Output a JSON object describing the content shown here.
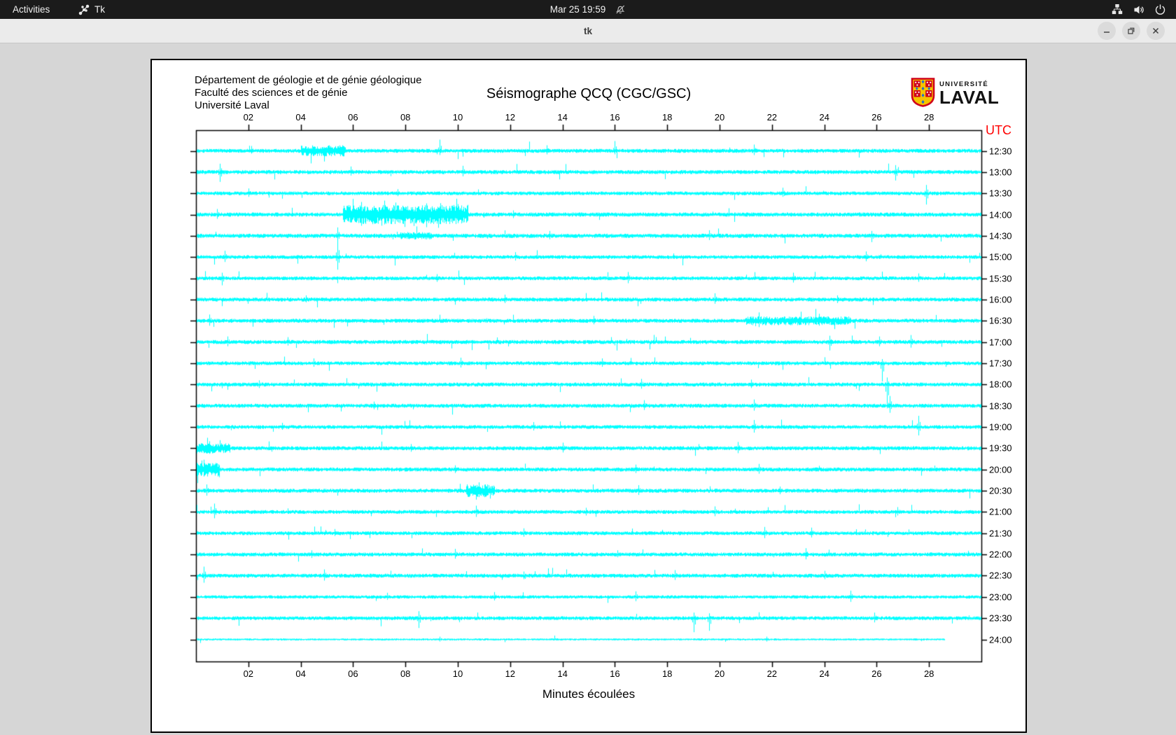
{
  "topbar": {
    "activities_label": "Activities",
    "app_name": "Tk",
    "clock": "Mar 25 19:59",
    "icons": [
      "tk-icon",
      "notifications-off-icon",
      "network-icon",
      "volume-icon",
      "power-icon"
    ]
  },
  "window": {
    "title": "tk",
    "control_icons": [
      "minimize-icon",
      "maximize-icon",
      "close-icon"
    ]
  },
  "header": {
    "department_lines": [
      "Département de géologie et de génie géologique",
      "Faculté des sciences et de génie",
      "Université Laval"
    ],
    "logo": {
      "small_text": "UNIVERSITÉ",
      "large_text": "LAVAL"
    }
  },
  "chart_data": {
    "type": "line",
    "subtype": "helicorder-seismogram",
    "title": "Séismographe QCQ (CGC/GSC)",
    "xlabel": "Minutes écoulées",
    "right_axis_title": "UTC",
    "right_axis_title_color": "#ff0000",
    "trace_color": "#00ffff",
    "axis_color": "#000000",
    "x_range_minutes": [
      0,
      30
    ],
    "x_ticks": [
      "02",
      "04",
      "06",
      "08",
      "10",
      "12",
      "14",
      "16",
      "18",
      "20",
      "22",
      "24",
      "26",
      "28"
    ],
    "grid": false,
    "legend": "none",
    "rows": [
      {
        "label": "12:30",
        "seed": 101,
        "noise": 1.8,
        "srate": 0.01,
        "samp": 11,
        "bursts": [
          {
            "from": 4.0,
            "to": 5.7,
            "gain": 2.8
          }
        ],
        "events": [
          {
            "at": 2.1,
            "up": 7,
            "dn": 4
          },
          {
            "at": 9.3,
            "up": 16,
            "dn": 6
          },
          {
            "at": 13.4,
            "up": 8,
            "dn": 5
          },
          {
            "at": 16.0,
            "up": 14,
            "dn": 5
          },
          {
            "at": 21.3,
            "up": 9,
            "dn": 6
          }
        ],
        "end": 30
      },
      {
        "label": "13:00",
        "seed": 102,
        "noise": 1.8,
        "srate": 0.009,
        "samp": 10,
        "bursts": [],
        "events": [
          {
            "at": 0.9,
            "up": 12,
            "dn": 14
          },
          {
            "at": 5.9,
            "up": 8,
            "dn": 5
          },
          {
            "at": 10.2,
            "up": 9,
            "dn": 6
          },
          {
            "at": 26.7,
            "up": 10,
            "dn": 12
          }
        ],
        "end": 30
      },
      {
        "label": "13:30",
        "seed": 103,
        "noise": 1.7,
        "srate": 0.008,
        "samp": 9,
        "bursts": [],
        "events": [
          {
            "at": 2.0,
            "up": 7,
            "dn": 5
          },
          {
            "at": 7.7,
            "up": 6,
            "dn": 4
          },
          {
            "at": 22.4,
            "up": 8,
            "dn": 5
          },
          {
            "at": 27.9,
            "up": 12,
            "dn": 16
          }
        ],
        "end": 30
      },
      {
        "label": "14:00",
        "seed": 104,
        "noise": 1.9,
        "srate": 0.011,
        "samp": 11,
        "bursts": [
          {
            "from": 5.6,
            "to": 10.4,
            "gain": 4.5
          }
        ],
        "events": [
          {
            "at": 0.8,
            "up": 8,
            "dn": 6
          },
          {
            "at": 6.3,
            "up": 18,
            "dn": 16
          },
          {
            "at": 7.2,
            "up": 20,
            "dn": 14
          },
          {
            "at": 8.8,
            "up": 16,
            "dn": 18
          },
          {
            "at": 10.0,
            "up": 15,
            "dn": 12
          },
          {
            "at": 12.1,
            "up": 6,
            "dn": 5
          }
        ],
        "end": 30
      },
      {
        "label": "14:30",
        "seed": 105,
        "noise": 1.9,
        "srate": 0.01,
        "samp": 10,
        "bursts": [
          {
            "from": 7.8,
            "to": 9.0,
            "gain": 1.8
          }
        ],
        "events": [
          {
            "at": 5.4,
            "up": 12,
            "dn": 9
          },
          {
            "at": 13.5,
            "up": 7,
            "dn": 5
          },
          {
            "at": 19.6,
            "up": 8,
            "dn": 6
          },
          {
            "at": 25.8,
            "up": 7,
            "dn": 9
          }
        ],
        "end": 30
      },
      {
        "label": "15:00",
        "seed": 106,
        "noise": 1.7,
        "srate": 0.009,
        "samp": 10,
        "bursts": [],
        "events": [
          {
            "at": 1.1,
            "up": 9,
            "dn": 7
          },
          {
            "at": 5.4,
            "up": 22,
            "dn": 18
          },
          {
            "at": 12.2,
            "up": 7,
            "dn": 5
          },
          {
            "at": 25.6,
            "up": 8,
            "dn": 6
          }
        ],
        "end": 30
      },
      {
        "label": "15:30",
        "seed": 107,
        "noise": 1.7,
        "srate": 0.009,
        "samp": 10,
        "bursts": [],
        "events": [
          {
            "at": 1.0,
            "up": 8,
            "dn": 10
          },
          {
            "at": 9.2,
            "up": 6,
            "dn": 5
          },
          {
            "at": 16.5,
            "up": 9,
            "dn": 7
          },
          {
            "at": 22.8,
            "up": 8,
            "dn": 6
          },
          {
            "at": 27.6,
            "up": 7,
            "dn": 5
          }
        ],
        "end": 30
      },
      {
        "label": "16:00",
        "seed": 108,
        "noise": 1.8,
        "srate": 0.008,
        "samp": 9,
        "bursts": [],
        "events": [
          {
            "at": 4.2,
            "up": 6,
            "dn": 4
          },
          {
            "at": 11.8,
            "up": 7,
            "dn": 5
          },
          {
            "at": 19.8,
            "up": 9,
            "dn": 6
          },
          {
            "at": 24.5,
            "up": 6,
            "dn": 5
          }
        ],
        "end": 30
      },
      {
        "label": "16:30",
        "seed": 109,
        "noise": 1.8,
        "srate": 0.01,
        "samp": 10,
        "bursts": [
          {
            "from": 21.0,
            "to": 25.0,
            "gain": 2.2
          }
        ],
        "events": [
          {
            "at": 0.5,
            "up": 9,
            "dn": 7
          },
          {
            "at": 15.2,
            "up": 7,
            "dn": 5
          },
          {
            "at": 21.5,
            "up": 12,
            "dn": 9
          },
          {
            "at": 23.8,
            "up": 10,
            "dn": 7
          }
        ],
        "end": 30
      },
      {
        "label": "17:00",
        "seed": 110,
        "noise": 1.8,
        "srate": 0.009,
        "samp": 10,
        "bursts": [],
        "events": [
          {
            "at": 1.2,
            "up": 8,
            "dn": 6
          },
          {
            "at": 3.5,
            "up": 7,
            "dn": 5
          },
          {
            "at": 24.2,
            "up": 9,
            "dn": 12
          },
          {
            "at": 26.1,
            "up": 8,
            "dn": 6
          },
          {
            "at": 27.3,
            "up": 10,
            "dn": 8
          }
        ],
        "end": 30
      },
      {
        "label": "17:30",
        "seed": 111,
        "noise": 1.7,
        "srate": 0.009,
        "samp": 9,
        "bursts": [],
        "events": [
          {
            "at": 4.5,
            "up": 7,
            "dn": 5
          },
          {
            "at": 10.1,
            "up": 8,
            "dn": 6
          },
          {
            "at": 15.5,
            "up": 7,
            "dn": 5
          },
          {
            "at": 26.2,
            "up": 6,
            "dn": 26
          }
        ],
        "end": 30
      },
      {
        "label": "18:00",
        "seed": 112,
        "noise": 1.8,
        "srate": 0.009,
        "samp": 10,
        "bursts": [],
        "events": [
          {
            "at": 2.4,
            "up": 6,
            "dn": 5
          },
          {
            "at": 17.0,
            "up": 8,
            "dn": 6
          },
          {
            "at": 21.2,
            "up": 7,
            "dn": 5
          },
          {
            "at": 26.4,
            "up": 10,
            "dn": 34
          }
        ],
        "end": 30
      },
      {
        "label": "18:30",
        "seed": 113,
        "noise": 1.8,
        "srate": 0.009,
        "samp": 10,
        "bursts": [],
        "events": [
          {
            "at": 6.8,
            "up": 6,
            "dn": 5
          },
          {
            "at": 17.1,
            "up": 8,
            "dn": 6
          },
          {
            "at": 21.3,
            "up": 9,
            "dn": 7
          },
          {
            "at": 26.5,
            "up": 14,
            "dn": 10
          }
        ],
        "end": 30
      },
      {
        "label": "19:00",
        "seed": 114,
        "noise": 1.7,
        "srate": 0.009,
        "samp": 10,
        "bursts": [],
        "events": [
          {
            "at": 3.3,
            "up": 6,
            "dn": 4
          },
          {
            "at": 12.9,
            "up": 7,
            "dn": 5
          },
          {
            "at": 21.3,
            "up": 10,
            "dn": 8
          },
          {
            "at": 27.6,
            "up": 16,
            "dn": 12
          }
        ],
        "end": 30
      },
      {
        "label": "19:30",
        "seed": 115,
        "noise": 1.8,
        "srate": 0.01,
        "samp": 10,
        "bursts": [
          {
            "from": 0.0,
            "to": 1.3,
            "gain": 2.6
          }
        ],
        "events": [
          {
            "at": 0.5,
            "up": 10,
            "dn": 8
          },
          {
            "at": 8.2,
            "up": 6,
            "dn": 5
          },
          {
            "at": 14.0,
            "up": 8,
            "dn": 6
          },
          {
            "at": 20.7,
            "up": 9,
            "dn": 7
          }
        ],
        "end": 30
      },
      {
        "label": "20:00",
        "seed": 116,
        "noise": 1.8,
        "srate": 0.01,
        "samp": 10,
        "bursts": [
          {
            "from": 0.0,
            "to": 0.9,
            "gain": 3.5
          }
        ],
        "events": [
          {
            "at": 0.3,
            "up": 14,
            "dn": 10
          },
          {
            "at": 9.9,
            "up": 6,
            "dn": 5
          },
          {
            "at": 16.8,
            "up": 7,
            "dn": 5
          },
          {
            "at": 21.5,
            "up": 8,
            "dn": 6
          }
        ],
        "end": 30
      },
      {
        "label": "20:30",
        "seed": 117,
        "noise": 1.8,
        "srate": 0.01,
        "samp": 10,
        "bursts": [
          {
            "from": 10.3,
            "to": 11.4,
            "gain": 3.2
          }
        ],
        "events": [
          {
            "at": 0.4,
            "up": 9,
            "dn": 7
          },
          {
            "at": 10.8,
            "up": 12,
            "dn": 9
          },
          {
            "at": 16.9,
            "up": 8,
            "dn": 6
          },
          {
            "at": 22.3,
            "up": 6,
            "dn": 5
          }
        ],
        "end": 30
      },
      {
        "label": "21:00",
        "seed": 118,
        "noise": 1.7,
        "srate": 0.009,
        "samp": 10,
        "bursts": [],
        "events": [
          {
            "at": 0.7,
            "up": 12,
            "dn": 9
          },
          {
            "at": 10.7,
            "up": 9,
            "dn": 7
          },
          {
            "at": 14.9,
            "up": 6,
            "dn": 5
          },
          {
            "at": 19.8,
            "up": 8,
            "dn": 6
          },
          {
            "at": 26.8,
            "up": 7,
            "dn": 5
          }
        ],
        "end": 30
      },
      {
        "label": "21:30",
        "seed": 119,
        "noise": 1.7,
        "srate": 0.008,
        "samp": 9,
        "bursts": [],
        "events": [
          {
            "at": 5.3,
            "up": 6,
            "dn": 4
          },
          {
            "at": 12.5,
            "up": 7,
            "dn": 5
          },
          {
            "at": 21.7,
            "up": 9,
            "dn": 7
          },
          {
            "at": 23.5,
            "up": 8,
            "dn": 6
          }
        ],
        "end": 30
      },
      {
        "label": "22:00",
        "seed": 120,
        "noise": 1.8,
        "srate": 0.009,
        "samp": 9,
        "bursts": [],
        "events": [
          {
            "at": 4.4,
            "up": 6,
            "dn": 5
          },
          {
            "at": 9.9,
            "up": 8,
            "dn": 6
          },
          {
            "at": 16.1,
            "up": 6,
            "dn": 4
          },
          {
            "at": 23.3,
            "up": 9,
            "dn": 7
          }
        ],
        "end": 30
      },
      {
        "label": "22:30",
        "seed": 121,
        "noise": 1.8,
        "srate": 0.009,
        "samp": 10,
        "bursts": [],
        "events": [
          {
            "at": 0.3,
            "up": 13,
            "dn": 10
          },
          {
            "at": 4.9,
            "up": 9,
            "dn": 7
          },
          {
            "at": 12.5,
            "up": 6,
            "dn": 5
          },
          {
            "at": 18.3,
            "up": 8,
            "dn": 6
          },
          {
            "at": 24.0,
            "up": 7,
            "dn": 5
          }
        ],
        "end": 30
      },
      {
        "label": "23:00",
        "seed": 122,
        "noise": 1.5,
        "srate": 0.007,
        "samp": 8,
        "bursts": [],
        "events": [
          {
            "at": 7.3,
            "up": 6,
            "dn": 4
          },
          {
            "at": 11.4,
            "up": 7,
            "dn": 5
          },
          {
            "at": 16.8,
            "up": 8,
            "dn": 6
          },
          {
            "at": 25.0,
            "up": 9,
            "dn": 7
          }
        ],
        "end": 30
      },
      {
        "label": "23:30",
        "seed": 123,
        "noise": 1.7,
        "srate": 0.008,
        "samp": 9,
        "bursts": [],
        "events": [
          {
            "at": 8.5,
            "up": 10,
            "dn": 14
          },
          {
            "at": 19.0,
            "up": 8,
            "dn": 20
          },
          {
            "at": 19.6,
            "up": 7,
            "dn": 18
          },
          {
            "at": 25.9,
            "up": 8,
            "dn": 6
          }
        ],
        "end": 30
      },
      {
        "label": "24:00",
        "seed": 124,
        "noise": 0.9,
        "srate": 0.003,
        "samp": 5,
        "bursts": [],
        "events": [
          {
            "at": 9.3,
            "up": 4,
            "dn": 3
          },
          {
            "at": 21.8,
            "up": 4,
            "dn": 3
          }
        ],
        "end": 28.6
      }
    ]
  }
}
